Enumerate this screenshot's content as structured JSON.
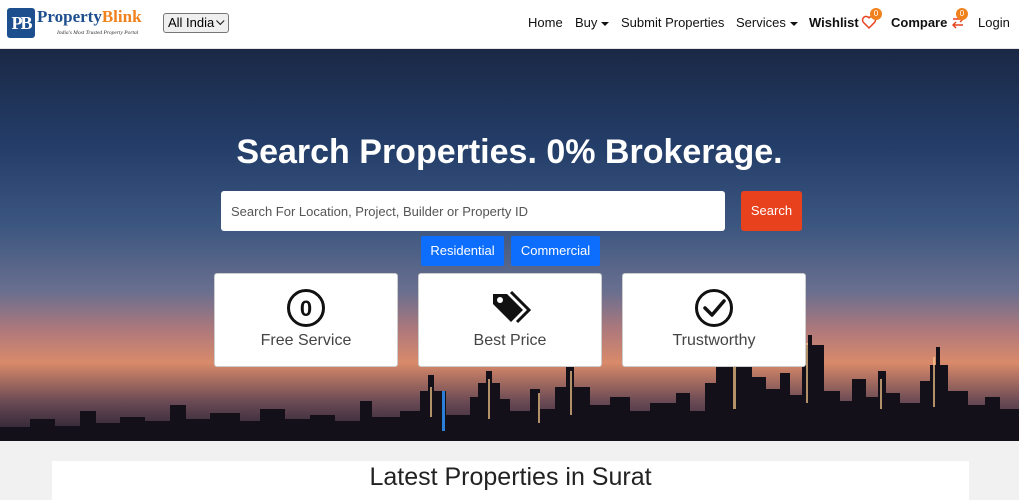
{
  "brand": {
    "name_part1": "Property",
    "name_part2": "Blink",
    "tagline": "India's Most Trusted Property Portal",
    "mark": "PB",
    "primary_color": "#1d4f8f",
    "accent_color": "#f0821e"
  },
  "region_select": {
    "value": "All India"
  },
  "nav": {
    "home": "Home",
    "buy": "Buy",
    "submit": "Submit Properties",
    "services": "Services",
    "wishlist": "Wishlist",
    "wishlist_count": "0",
    "compare": "Compare",
    "compare_count": "0",
    "login": "Login"
  },
  "hero": {
    "title": "Search Properties. 0% Brokerage.",
    "search_placeholder": "Search For Location, Project, Builder or Property ID",
    "search_button": "Search",
    "search_button_color": "#e8411e",
    "type_buttons": [
      "Residential",
      "Commercial"
    ],
    "type_button_color": "#0d6efd"
  },
  "features": [
    {
      "label": "Free Service",
      "icon": "zero-circle-icon",
      "icon_text": "0"
    },
    {
      "label": "Best Price",
      "icon": "price-tag-icon"
    },
    {
      "label": "Trustworthy",
      "icon": "check-circle-icon"
    }
  ],
  "latest": {
    "title": "Latest Properties in Surat"
  }
}
